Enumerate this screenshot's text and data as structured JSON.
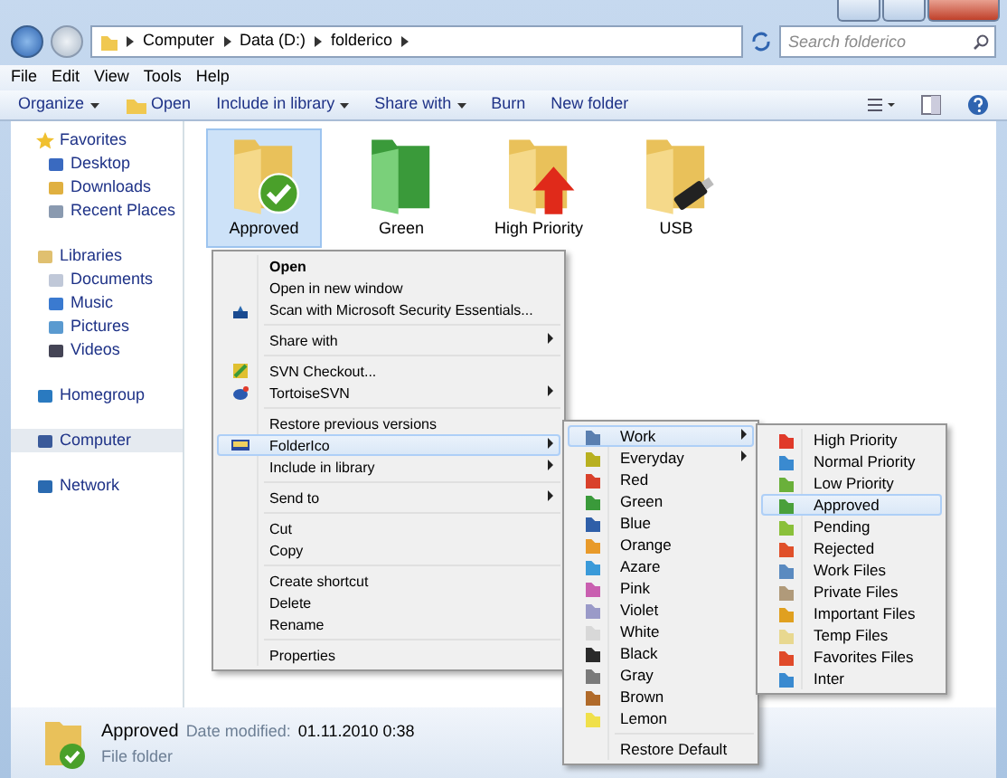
{
  "address_bar": {
    "breadcrumb": [
      "Computer",
      "Data (D:)",
      "folderico"
    ],
    "search_placeholder": "Search folderico"
  },
  "menu_bar": [
    "File",
    "Edit",
    "View",
    "Tools",
    "Help"
  ],
  "toolbar": [
    {
      "label": "Organize",
      "dropdown": true,
      "icon": false
    },
    {
      "label": "Open",
      "dropdown": false,
      "icon": true
    },
    {
      "label": "Include in library",
      "dropdown": true,
      "icon": false
    },
    {
      "label": "Share with",
      "dropdown": true,
      "icon": false
    },
    {
      "label": "Burn",
      "dropdown": false,
      "icon": false
    },
    {
      "label": "New folder",
      "dropdown": false,
      "icon": false
    }
  ],
  "sidebar": [
    {
      "label": "Favorites",
      "kind": "star",
      "selected": false,
      "children": [
        {
          "label": "Desktop",
          "kind": "desktop",
          "selected": false
        },
        {
          "label": "Downloads",
          "kind": "downloads",
          "selected": false
        },
        {
          "label": "Recent Places",
          "kind": "recent",
          "selected": false
        }
      ]
    },
    {
      "label": "Libraries",
      "kind": "library",
      "selected": false,
      "children": [
        {
          "label": "Documents",
          "kind": "documents",
          "selected": false
        },
        {
          "label": "Music",
          "kind": "music",
          "selected": false
        },
        {
          "label": "Pictures",
          "kind": "pictures",
          "selected": false
        },
        {
          "label": "Videos",
          "kind": "videos",
          "selected": false
        }
      ]
    },
    {
      "label": "Homegroup",
      "kind": "homegroup",
      "selected": false
    },
    {
      "label": "Computer",
      "kind": "computer",
      "selected": true
    },
    {
      "label": "Network",
      "kind": "network",
      "selected": false
    }
  ],
  "folders": [
    {
      "label": "Approved",
      "kind": "approved",
      "selected": true
    },
    {
      "label": "Green",
      "kind": "green",
      "selected": false
    },
    {
      "label": "High Priority",
      "kind": "priority",
      "selected": false
    },
    {
      "label": "USB",
      "kind": "usb",
      "selected": false
    }
  ],
  "context_menu": [
    {
      "kind": "item",
      "label": "Open",
      "default": true,
      "submenu": false,
      "selected": false
    },
    {
      "kind": "item",
      "label": "Open in new window",
      "default": false,
      "submenu": false,
      "selected": false
    },
    {
      "kind": "item",
      "label": "Scan with Microsoft Security Essentials...",
      "default": false,
      "submenu": false,
      "selected": false
    },
    {
      "kind": "separator"
    },
    {
      "kind": "item",
      "label": "Share with",
      "default": false,
      "submenu": true,
      "selected": false
    },
    {
      "kind": "separator"
    },
    {
      "kind": "item",
      "label": "SVN Checkout...",
      "default": false,
      "submenu": false,
      "selected": false
    },
    {
      "kind": "item",
      "label": "TortoiseSVN",
      "default": false,
      "submenu": true,
      "selected": false
    },
    {
      "kind": "separator"
    },
    {
      "kind": "item",
      "label": "Restore previous versions",
      "default": false,
      "submenu": false,
      "selected": false
    },
    {
      "kind": "item",
      "label": "FolderIco",
      "default": false,
      "submenu": true,
      "selected": true
    },
    {
      "kind": "item",
      "label": "Include in library",
      "default": false,
      "submenu": true,
      "selected": false
    },
    {
      "kind": "separator"
    },
    {
      "kind": "item",
      "label": "Send to",
      "default": false,
      "submenu": true,
      "selected": false
    },
    {
      "kind": "separator"
    },
    {
      "kind": "item",
      "label": "Cut",
      "default": false,
      "submenu": false,
      "selected": false
    },
    {
      "kind": "item",
      "label": "Copy",
      "default": false,
      "submenu": false,
      "selected": false
    },
    {
      "kind": "separator"
    },
    {
      "kind": "item",
      "label": "Create shortcut",
      "default": false,
      "submenu": false,
      "selected": false
    },
    {
      "kind": "item",
      "label": "Delete",
      "default": false,
      "submenu": false,
      "selected": false
    },
    {
      "kind": "item",
      "label": "Rename",
      "default": false,
      "submenu": false,
      "selected": false
    },
    {
      "kind": "separator"
    },
    {
      "kind": "item",
      "label": "Properties",
      "default": false,
      "submenu": false,
      "selected": false
    }
  ],
  "folderico_menu": [
    {
      "kind": "item",
      "label": "Work",
      "submenu": true,
      "selected": true,
      "color": "#5a7fb0"
    },
    {
      "kind": "item",
      "label": "Everyday",
      "submenu": true,
      "selected": false,
      "color": "#b8b020"
    },
    {
      "kind": "item",
      "label": "Red",
      "submenu": false,
      "selected": false,
      "color": "#d9412b"
    },
    {
      "kind": "item",
      "label": "Green",
      "submenu": false,
      "selected": false,
      "color": "#3a9a3a"
    },
    {
      "kind": "item",
      "label": "Blue",
      "submenu": false,
      "selected": false,
      "color": "#2f5fa8"
    },
    {
      "kind": "item",
      "label": "Orange",
      "submenu": false,
      "selected": false,
      "color": "#e89a2a"
    },
    {
      "kind": "item",
      "label": "Azare",
      "submenu": false,
      "selected": false,
      "color": "#3a9ad9"
    },
    {
      "kind": "item",
      "label": "Pink",
      "submenu": false,
      "selected": false,
      "color": "#c95fb0"
    },
    {
      "kind": "item",
      "label": "Violet",
      "submenu": false,
      "selected": false,
      "color": "#9a9ac8"
    },
    {
      "kind": "item",
      "label": "White",
      "submenu": false,
      "selected": false,
      "color": "#d8d8d8"
    },
    {
      "kind": "item",
      "label": "Black",
      "submenu": false,
      "selected": false,
      "color": "#2a2a2a"
    },
    {
      "kind": "item",
      "label": "Gray",
      "submenu": false,
      "selected": false,
      "color": "#7a7a7a"
    },
    {
      "kind": "item",
      "label": "Brown",
      "submenu": false,
      "selected": false,
      "color": "#b06a2a"
    },
    {
      "kind": "item",
      "label": "Lemon",
      "submenu": false,
      "selected": false,
      "color": "#f0e04a"
    },
    {
      "kind": "separator"
    },
    {
      "kind": "item",
      "label": "Restore Default",
      "submenu": false,
      "selected": false
    }
  ],
  "work_menu": [
    {
      "label": "High Priority",
      "selected": false,
      "color": "#e03a2a"
    },
    {
      "label": "Normal Priority",
      "selected": false,
      "color": "#3a8ad0"
    },
    {
      "label": "Low Priority",
      "selected": false,
      "color": "#6ab03a"
    },
    {
      "label": "Approved",
      "selected": true,
      "color": "#4aa03a"
    },
    {
      "label": "Pending",
      "selected": false,
      "color": "#8ac03a"
    },
    {
      "label": "Rejected",
      "selected": false,
      "color": "#e0502a"
    },
    {
      "label": "Work Files",
      "selected": false,
      "color": "#5a8ac0"
    },
    {
      "label": "Private Files",
      "selected": false,
      "color": "#b09a7a"
    },
    {
      "label": "Important Files",
      "selected": false,
      "color": "#e0a020"
    },
    {
      "label": "Temp Files",
      "selected": false,
      "color": "#e8d890"
    },
    {
      "label": "Favorites Files",
      "selected": false,
      "color": "#e04a2a"
    },
    {
      "label": "Inter",
      "selected": false,
      "color": "#3a8ad0"
    }
  ],
  "details": {
    "name": "Approved",
    "date_label": "Date modified:",
    "date": "01.11.2010 0:38",
    "type": "File folder"
  }
}
